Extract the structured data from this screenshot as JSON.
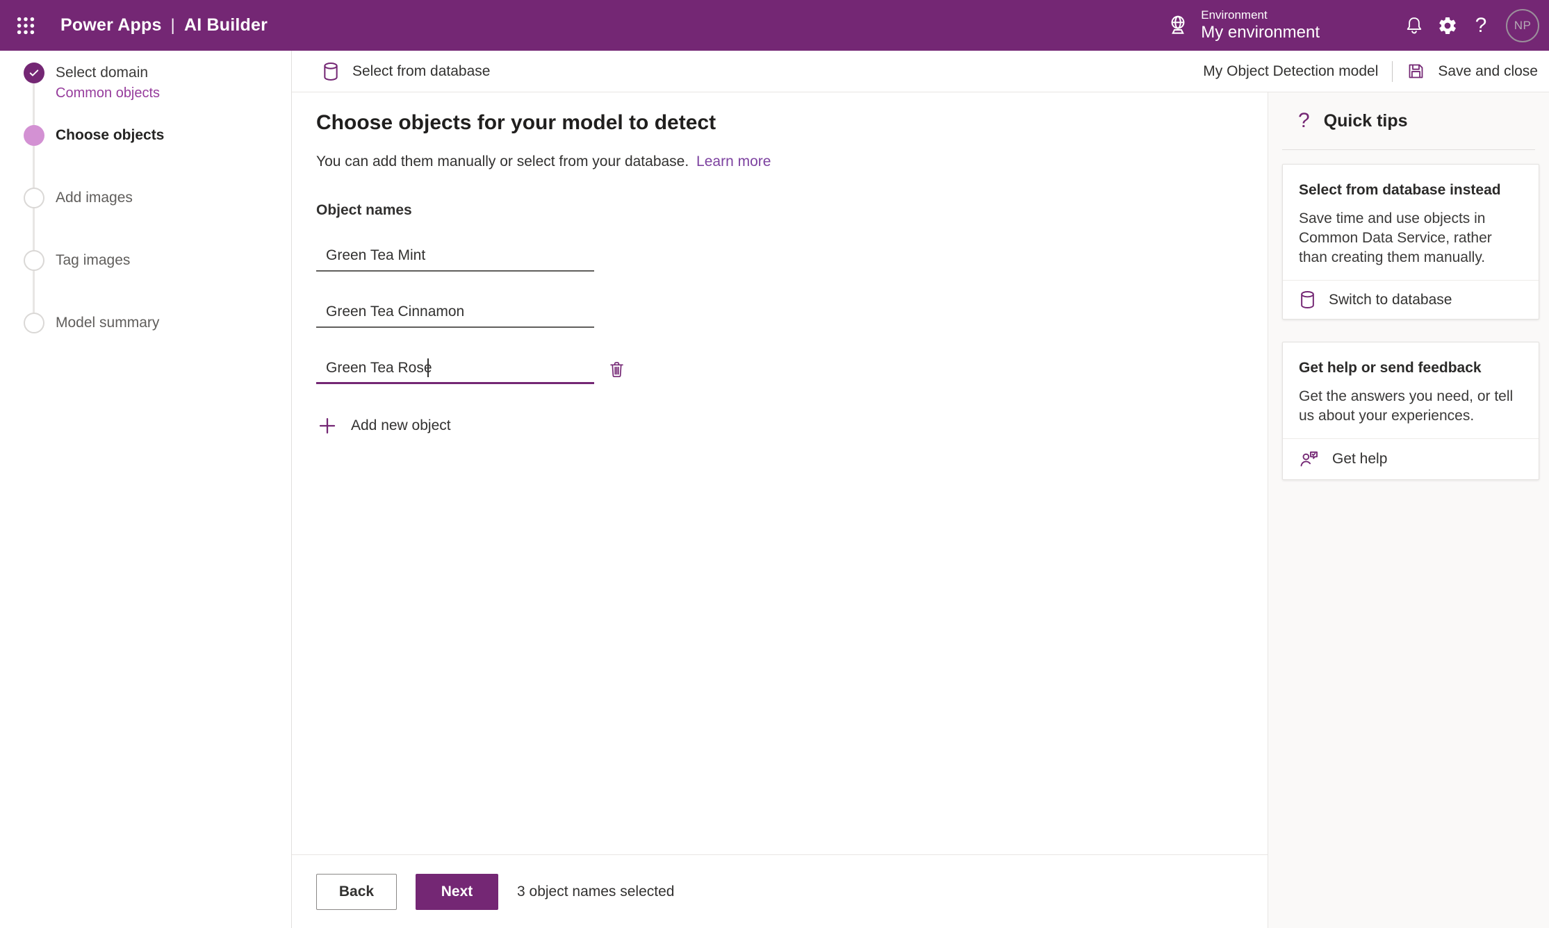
{
  "colors": {
    "accent": "#742774",
    "accent_light": "#d391d3",
    "link": "#7d42a0",
    "sublabel_purple": "#963c9c",
    "panel_bg": "#faf9f8",
    "text_primary": "#323130",
    "text_secondary": "#605e5c"
  },
  "header": {
    "brand": "Power Apps",
    "divider": "|",
    "product": "AI Builder",
    "environment_label": "Environment",
    "environment_name": "My environment",
    "avatar_initials": "NP"
  },
  "icons": {
    "help_glyph": "?"
  },
  "toolbar": {
    "select_from_database": "Select from database",
    "model_name": "My Object Detection model",
    "save_and_close": "Save and close"
  },
  "stepper": {
    "steps": [
      {
        "label": "Select domain",
        "sublabel": "Common objects",
        "state": "complete"
      },
      {
        "label": "Choose objects",
        "state": "current"
      },
      {
        "label": "Add images",
        "state": "upcoming"
      },
      {
        "label": "Tag images",
        "state": "upcoming"
      },
      {
        "label": "Model summary",
        "state": "upcoming"
      }
    ]
  },
  "main": {
    "heading": "Choose objects for your model to detect",
    "subtext": "You can add them manually or select from your database.",
    "learn_more": "Learn more",
    "object_names_label": "Object names",
    "objects": [
      "Green Tea Mint",
      "Green Tea Cinnamon",
      "Green Tea Rose"
    ],
    "add_new_object": "Add new object"
  },
  "footer": {
    "back_label": "Back",
    "next_label": "Next",
    "status": "3 object names selected"
  },
  "quick_tips": {
    "heading": "Quick tips",
    "cards": [
      {
        "title": "Select from database instead",
        "body": "Save time and use objects in Common Data Service, rather than creating them manually.",
        "action": "Switch to database"
      },
      {
        "title": "Get help or send feedback",
        "body": "Get the answers you need, or tell us about your experiences.",
        "action": "Get help"
      }
    ]
  }
}
